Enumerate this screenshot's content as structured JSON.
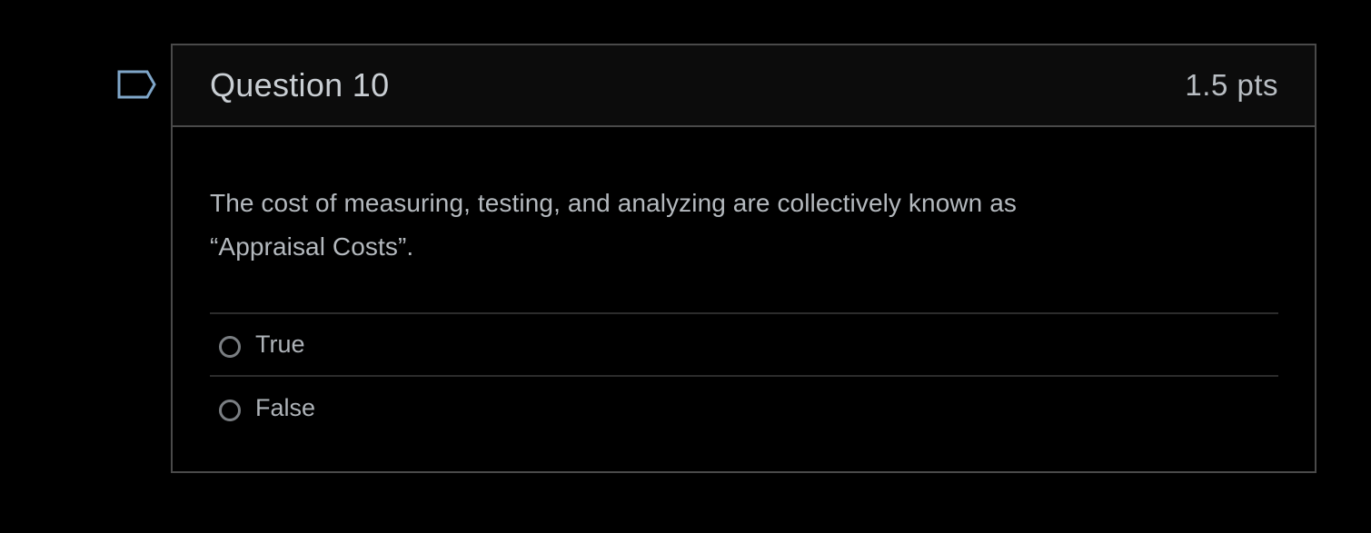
{
  "question": {
    "title": "Question 10",
    "points": "1.5 pts",
    "text": "The cost of measuring, testing, and analyzing are collectively known as “Appraisal Costs”.",
    "flag_icon": "flag-icon",
    "answers": [
      {
        "label": "True",
        "selected": false
      },
      {
        "label": "False",
        "selected": false
      }
    ]
  },
  "colors": {
    "background": "#000000",
    "border": "#4a4a4a",
    "flag": "#7fa6c9",
    "text": "#b4b9be"
  }
}
